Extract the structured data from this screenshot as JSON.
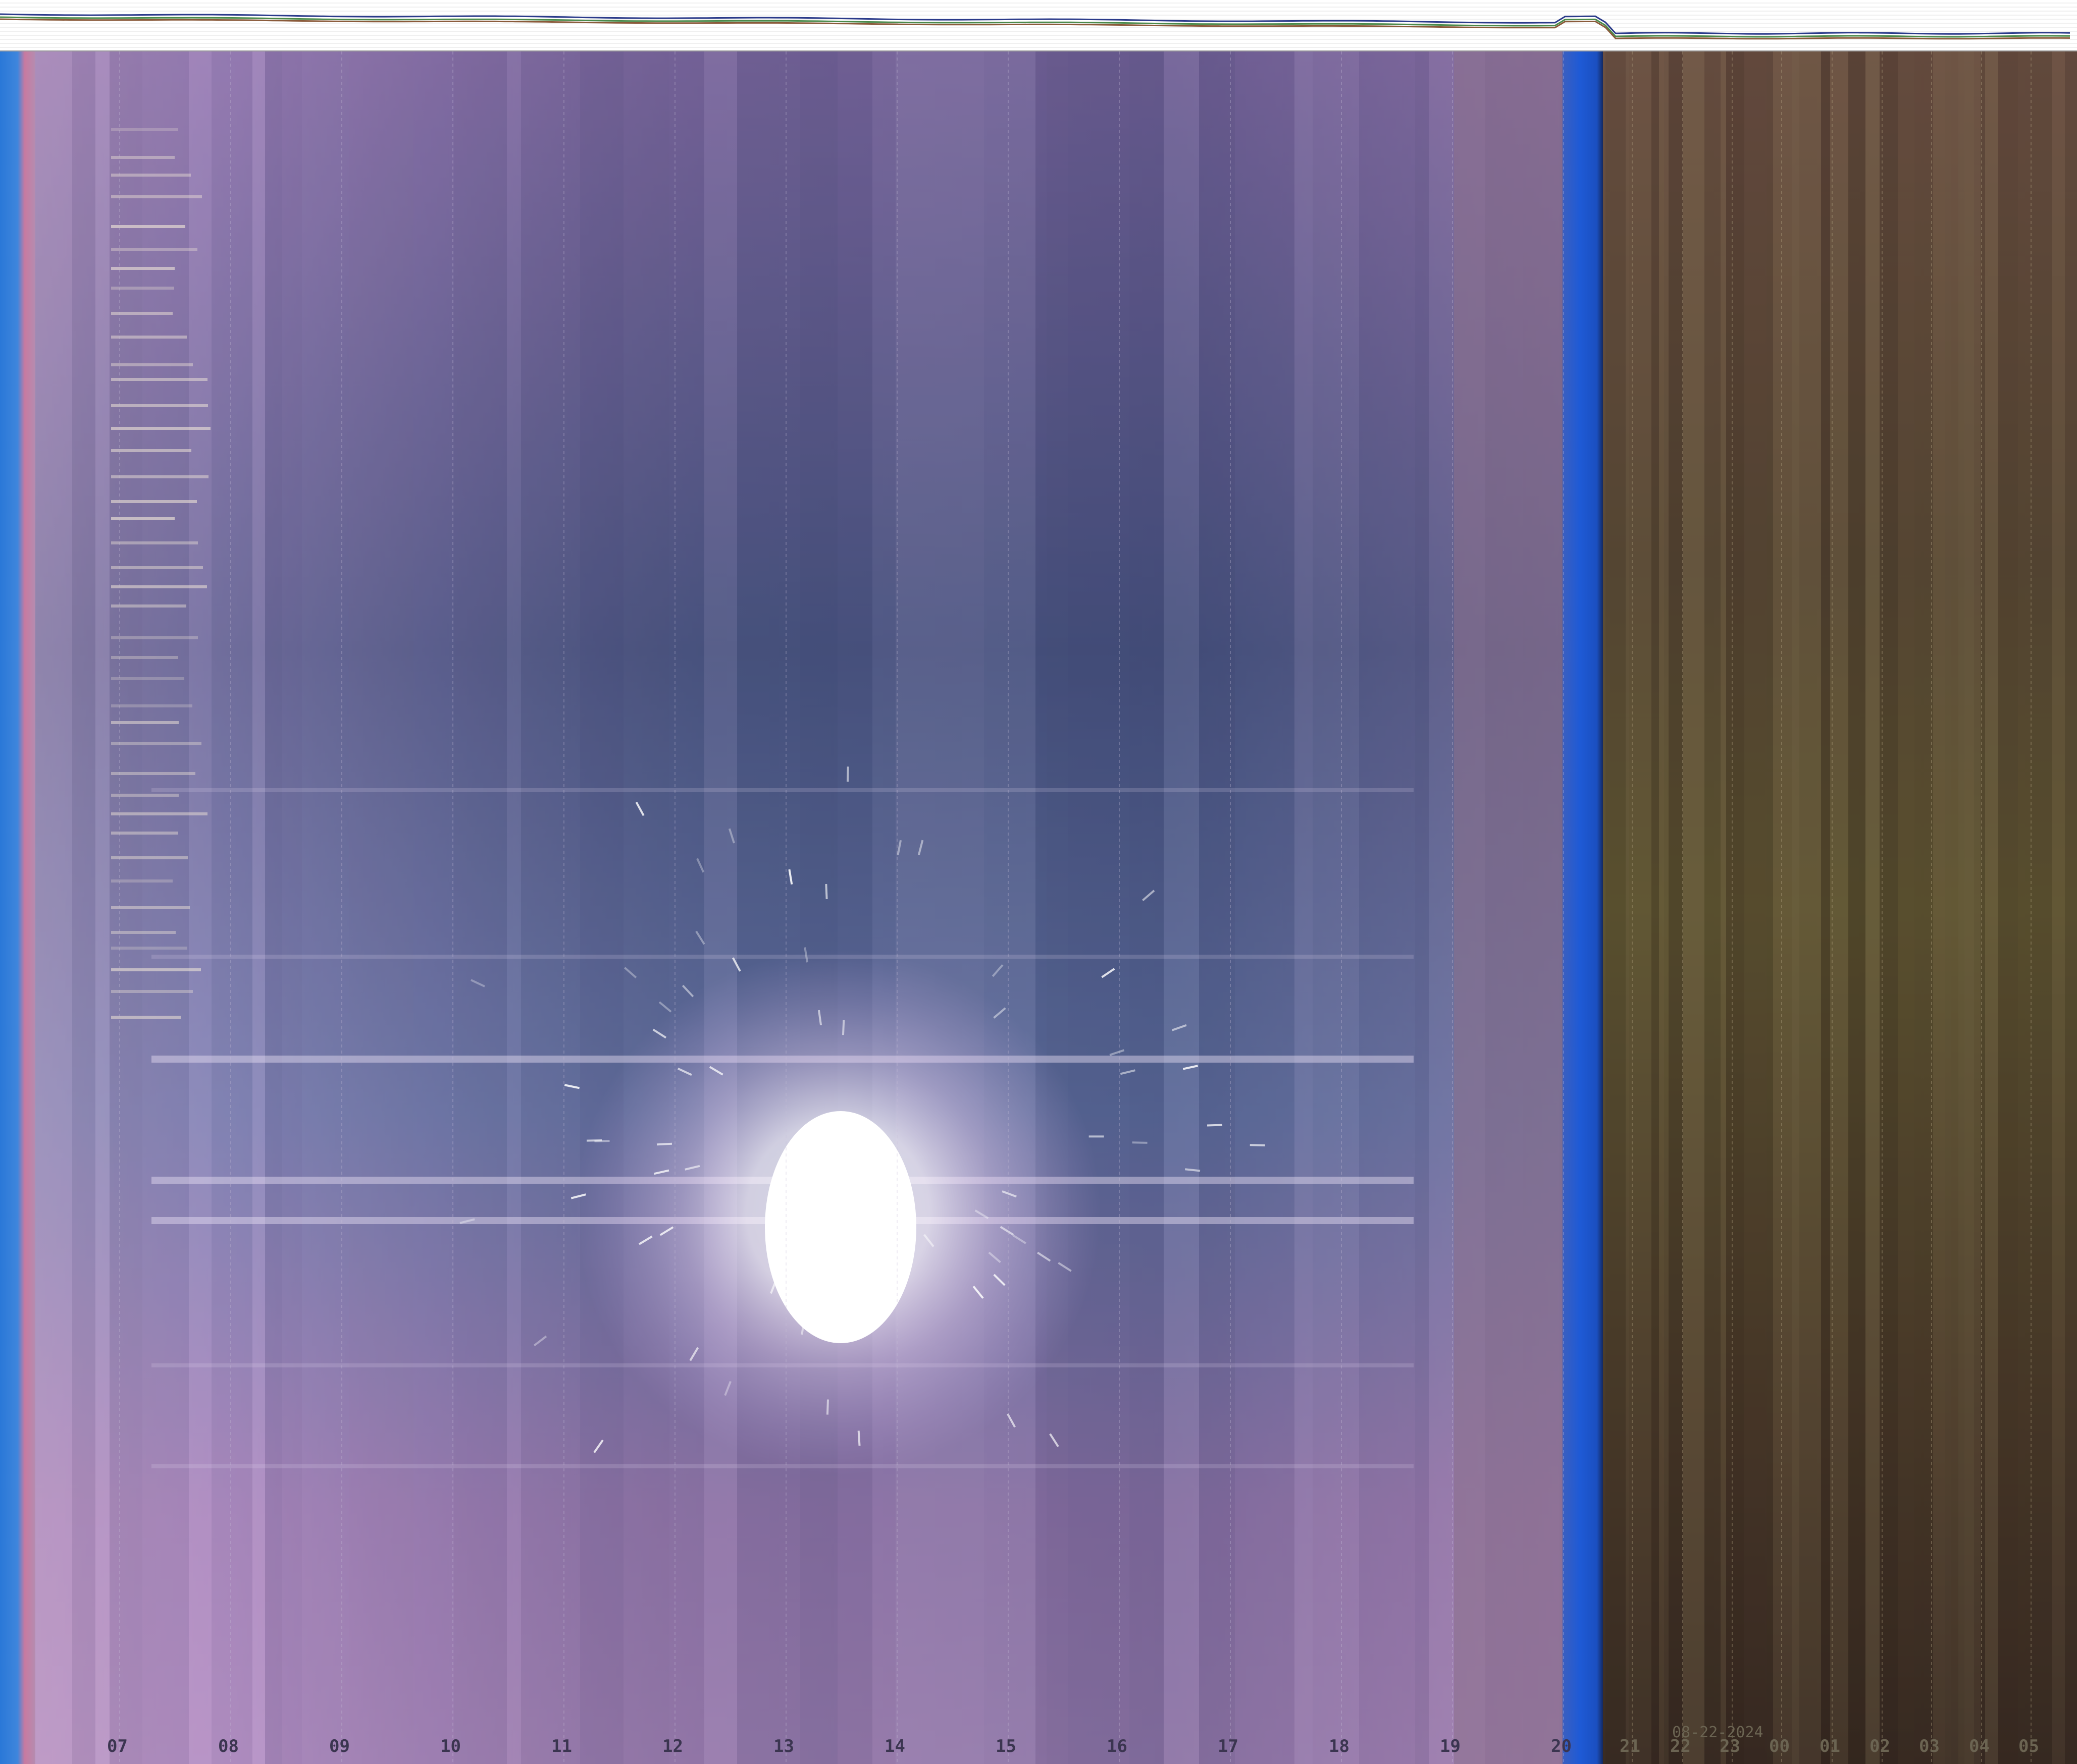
{
  "date_stamp": "08-22-2024",
  "hour_labels": [
    "07",
    "08",
    "09",
    "10",
    "11",
    "12",
    "13",
    "14",
    "15",
    "16",
    "17",
    "18",
    "19",
    "20",
    "21",
    "22",
    "23",
    "00",
    "01",
    "02",
    "03",
    "04",
    "05"
  ],
  "colors": {
    "day_sky_blue": "#5b6f9e",
    "day_sky_purple": "#a07fb4",
    "sun_glare": "#ffffff",
    "twilight_blue": "#1e5ad6",
    "night_olive": "#5e5432",
    "night_brown": "#3e2f26",
    "left_edge_blue": "#2a78d8",
    "left_edge_pink": "#c87aa0",
    "hour_label_day": "#3b3550",
    "hour_label_night": "#6b6452",
    "sensor_line_1": "#2a3a8a",
    "sensor_line_2": "#4a8a4a",
    "sensor_line_3": "#8a5a3a"
  }
}
